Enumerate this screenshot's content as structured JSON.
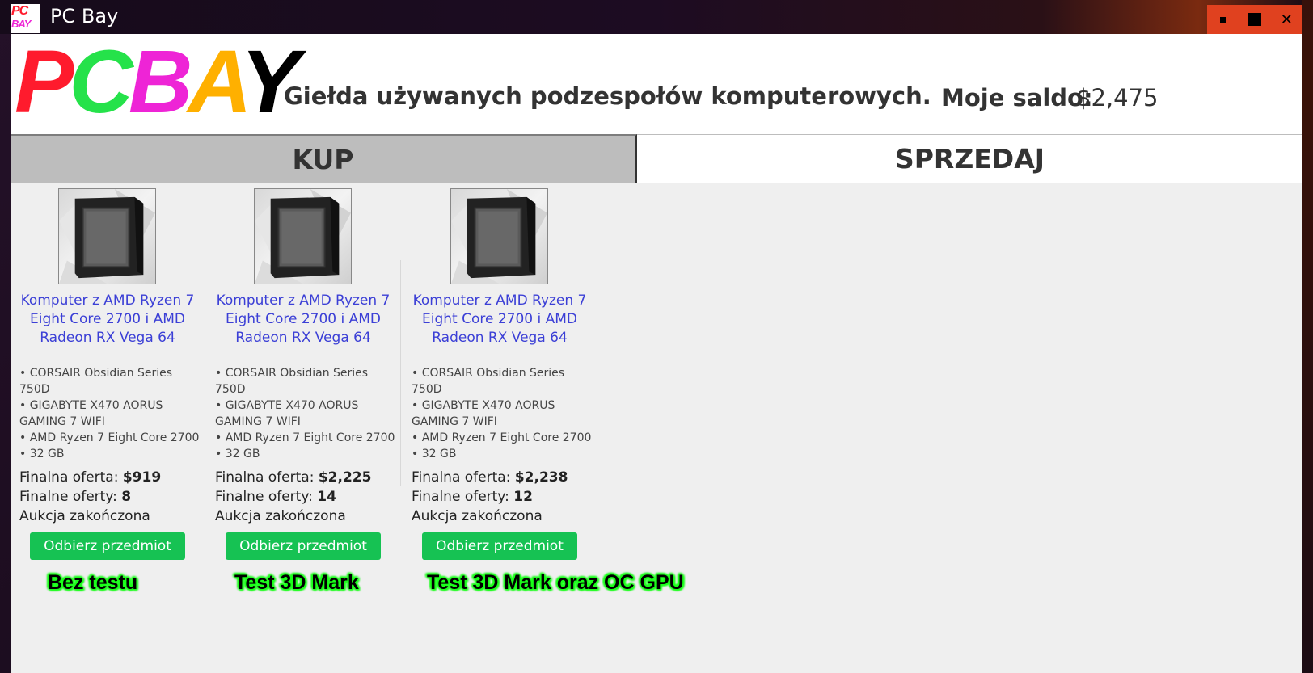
{
  "window": {
    "title": "PC Bay",
    "app_icon_top": "PC",
    "app_icon_bottom": "BAY",
    "controls": {
      "minimize": "▪",
      "maximize": "■",
      "close": "✕"
    }
  },
  "header": {
    "logo_letters": [
      {
        "char": "P",
        "color": "#ff1b2d"
      },
      {
        "char": "C",
        "color": "#25e24a"
      },
      {
        "char": "B",
        "color": "#ee24d6"
      },
      {
        "char": "A",
        "color": "#ffb000"
      },
      {
        "char": "Y",
        "color": "#000000"
      }
    ],
    "tagline": "Giełda używanych podzespołów komputerowych.",
    "balance_label": "Moje saldo:",
    "balance_value": "$2,475"
  },
  "tabs": [
    {
      "label": "KUP",
      "active": true
    },
    {
      "label": "SPRZEDAJ",
      "active": false
    }
  ],
  "listings": [
    {
      "title": "Komputer z AMD Ryzen 7 Eight Core 2700 i AMD Radeon RX Vega 64",
      "specs": [
        "• CORSAIR Obsidian Series 750D",
        "• GIGABYTE X470 AORUS GAMING 7 WIFI",
        "• AMD Ryzen 7 Eight Core 2700",
        "• 32 GB"
      ],
      "final_offer_label": "Finalna oferta:",
      "final_offer_value": "$919",
      "final_offers_label": "Finalne oferty:",
      "final_offers_value": "8",
      "status": "Aukcja zakończona",
      "button_label": "Odbierz przedmiot",
      "overlay": "Bez testu"
    },
    {
      "title": "Komputer z AMD Ryzen 7 Eight Core 2700 i AMD Radeon RX Vega 64",
      "specs": [
        "• CORSAIR Obsidian Series 750D",
        "• GIGABYTE X470 AORUS GAMING 7 WIFI",
        "• AMD Ryzen 7 Eight Core 2700",
        "• 32 GB"
      ],
      "final_offer_label": "Finalna oferta:",
      "final_offer_value": "$2,225",
      "final_offers_label": "Finalne oferty:",
      "final_offers_value": "14",
      "status": "Aukcja zakończona",
      "button_label": "Odbierz przedmiot",
      "overlay": "Test 3D Mark"
    },
    {
      "title": "Komputer z AMD Ryzen 7 Eight Core 2700 i AMD Radeon RX Vega 64",
      "specs": [
        "• CORSAIR Obsidian Series 750D",
        "• GIGABYTE X470 AORUS GAMING 7 WIFI",
        "• AMD Ryzen 7 Eight Core 2700",
        "• 32 GB"
      ],
      "final_offer_label": "Finalna oferta:",
      "final_offer_value": "$2,238",
      "final_offers_label": "Finalne oferty:",
      "final_offers_value": "12",
      "status": "Aukcja zakończona",
      "button_label": "Odbierz przedmiot",
      "overlay": "Test 3D Mark oraz OC GPU"
    }
  ],
  "colors": {
    "link": "#3b3fd6",
    "button": "#16c253",
    "overlay_glow": "#1bff1b",
    "close_area": "#e0411f"
  }
}
